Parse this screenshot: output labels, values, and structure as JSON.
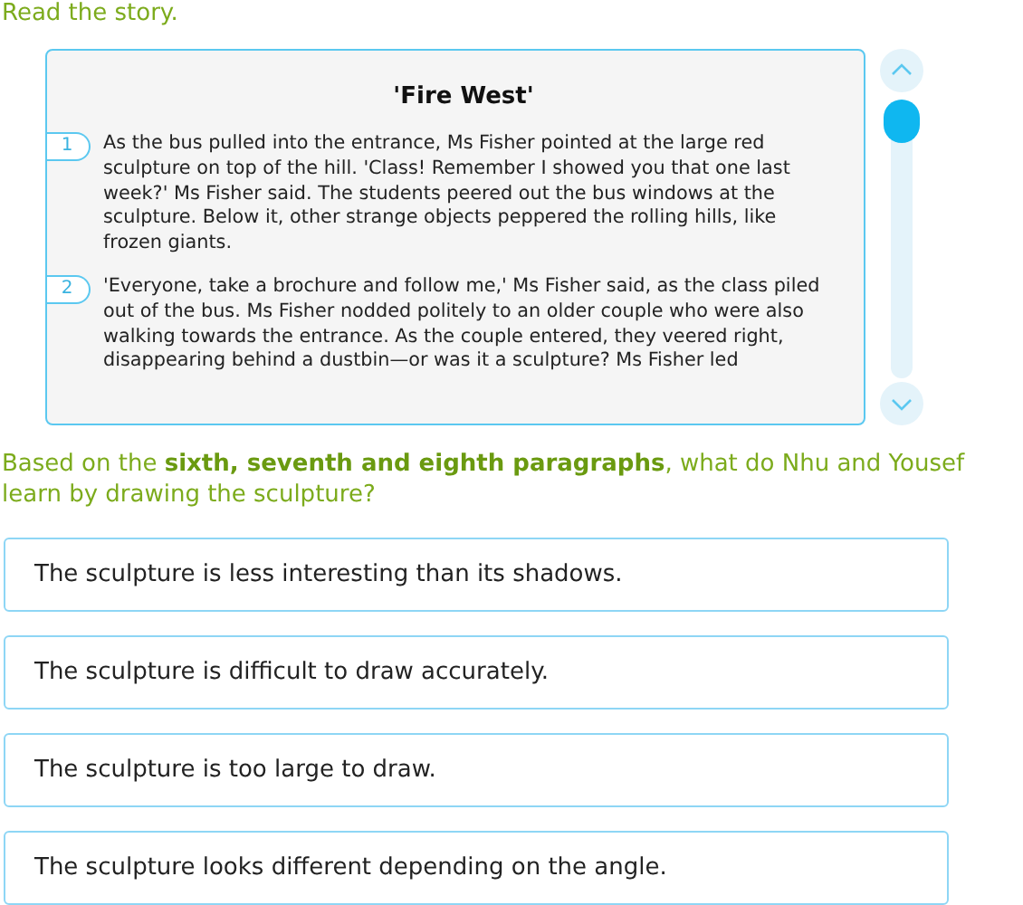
{
  "instruction": "Read the story.",
  "story": {
    "title": "'Fire West'",
    "paragraphs": [
      {
        "number": "1",
        "text": "As the bus pulled into the entrance, Ms Fisher pointed at the large red sculpture on top of the hill. 'Class! Remember I showed you that one last week?' Ms Fisher said. The students peered out the bus windows at the sculpture. Below it, other strange objects peppered the rolling hills, like frozen giants."
      },
      {
        "number": "2",
        "text": "'Everyone, take a brochure and follow me,' Ms Fisher said, as the class piled out of the bus. Ms Fisher nodded politely to an older couple who were also walking towards the entrance. As the couple entered, they veered right, disappearing behind a dustbin—or was it a sculpture? Ms Fisher led"
      }
    ]
  },
  "question": "Based on the **sixth, seventh and eighth paragraphs**, what do Nhu and Yousef learn by drawing the sculpture?",
  "options": [
    {
      "label": "The sculpture is less interesting than its shadows.",
      "selected": false
    },
    {
      "label": "The sculpture is difficult to draw accurately.",
      "selected": false
    },
    {
      "label": "The sculpture is too large to draw.",
      "selected": false
    },
    {
      "label": "The sculpture looks different depending on the angle.",
      "selected": false
    }
  ]
}
